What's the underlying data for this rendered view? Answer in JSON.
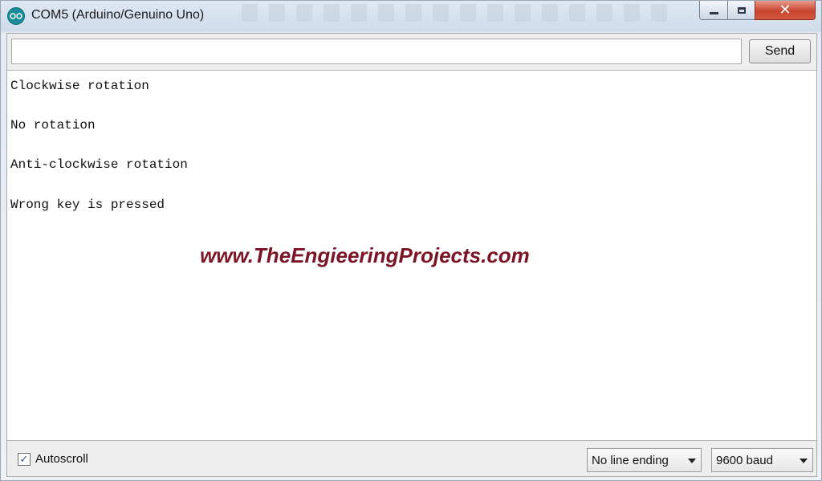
{
  "window": {
    "title": "COM5 (Arduino/Genuino Uno)"
  },
  "send_bar": {
    "input_value": "",
    "input_placeholder": "",
    "send_label": "Send"
  },
  "output": {
    "lines": [
      "Clockwise rotation",
      "No rotation",
      "Anti-clockwise rotation",
      "Wrong key is pressed"
    ],
    "watermark": "www.TheEngieeringProjects.com"
  },
  "footer": {
    "autoscroll_label": "Autoscroll",
    "autoscroll_checked": true,
    "line_ending_selected": "No line ending",
    "baud_selected": "9600 baud"
  },
  "colors": {
    "watermark": "#7b1525",
    "app_icon": "#1b8d98",
    "close_button": "#c7452e"
  },
  "icons": {
    "app": "arduino-infinity-icon",
    "check": "checkmark-icon"
  }
}
